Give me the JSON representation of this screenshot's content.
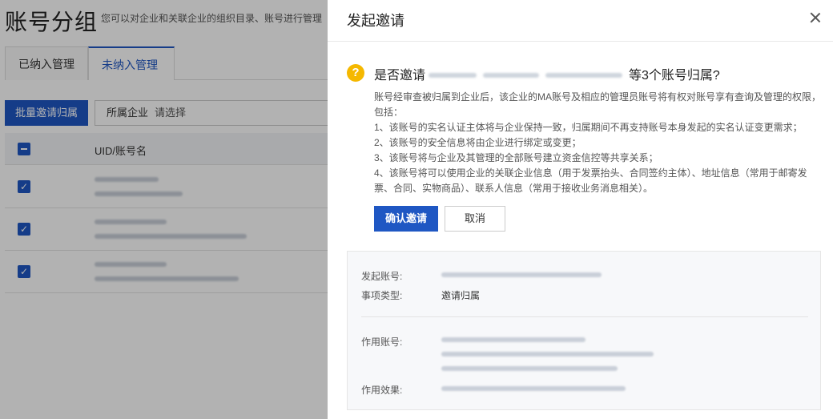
{
  "background": {
    "title": "账号分组",
    "subtitle": "您可以对企业和关联企业的组织目录、账号进行管理",
    "tabs": [
      {
        "label": "已纳入管理"
      },
      {
        "label": "未纳入管理"
      }
    ],
    "batch_button": "批量邀请归属",
    "filter": {
      "label": "所属企业",
      "placeholder": "请选择"
    },
    "table": {
      "column": "UID/账号名",
      "row_count": 3
    }
  },
  "drawer": {
    "title": "发起邀请",
    "question_prefix": "是否邀请",
    "question_suffix": "等3个账号归属?",
    "description": [
      "账号经审查被归属到企业后，该企业的MA账号及相应的管理员账号将有权对账号享有查询及管理的权限，包括：",
      "1、该账号的实名认证主体将与企业保持一致，归属期间不再支持账号本身发起的实名认证变更需求；",
      "2、该账号的安全信息将由企业进行绑定或变更；",
      "3、该账号将与企业及其管理的全部账号建立资金信控等共享关系；",
      "4、该账号将可以使用企业的关联企业信息（用于发票抬头、合同签约主体）、地址信息（常用于邮寄发票、合同、实物商品）、联系人信息（常用于接收业务消息相关）。"
    ],
    "confirm_button": "确认邀请",
    "cancel_button": "取消",
    "info": {
      "initiator_label": "发起账号:",
      "type_label": "事项类型:",
      "type_value": "邀请归属",
      "target_label": "作用账号:",
      "effect_label": "作用效果:"
    }
  },
  "colors": {
    "primary": "#1f57c3",
    "warning": "#f5b800"
  }
}
